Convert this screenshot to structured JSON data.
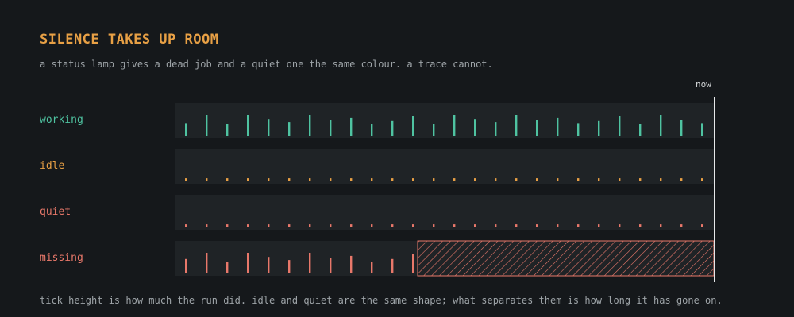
{
  "title": "SILENCE TAKES UP ROOM",
  "subtitle": "a status lamp gives a dead job and a quiet one the same colour. a trace cannot.",
  "now_label": "now",
  "footnote": "tick height is how much the run did. idle and quiet are the same shape; what separates them is how long it has gone on.",
  "colors": {
    "background": "#15181b",
    "lane": "#1f2326",
    "working": "#4fc3a1",
    "idle": "#e8a045",
    "quiet": "#e8786a",
    "missing": "#e8786a",
    "now_line": "#e6e8ea"
  },
  "chart_data": {
    "type": "timeline",
    "tick_count": 26,
    "value_meaning": "tick height = how much the run did (relative, 0-1)",
    "rows": [
      {
        "label": "working",
        "color_key": "working",
        "values": [
          0.6,
          1.0,
          0.55,
          1.0,
          0.8,
          0.65,
          1.0,
          0.75,
          0.85,
          0.55,
          0.7,
          0.95,
          0.55,
          1.0,
          0.8,
          0.65,
          1.0,
          0.75,
          0.85,
          0.6,
          0.7,
          0.95,
          0.55,
          1.0,
          0.75,
          0.6
        ],
        "missing_from_index": null
      },
      {
        "label": "idle",
        "color_key": "idle",
        "values": [
          0.15,
          0.15,
          0.15,
          0.15,
          0.15,
          0.15,
          0.15,
          0.15,
          0.15,
          0.15,
          0.15,
          0.15,
          0.15,
          0.15,
          0.15,
          0.15,
          0.15,
          0.15,
          0.15,
          0.15,
          0.15,
          0.15,
          0.15,
          0.15,
          0.15,
          0.15
        ],
        "missing_from_index": null
      },
      {
        "label": "quiet",
        "color_key": "quiet",
        "values": [
          0.15,
          0.15,
          0.15,
          0.15,
          0.15,
          0.15,
          0.15,
          0.15,
          0.15,
          0.15,
          0.15,
          0.15,
          0.15,
          0.15,
          0.15,
          0.15,
          0.15,
          0.15,
          0.15,
          0.15,
          0.15,
          0.15,
          0.15,
          0.15,
          0.15,
          0.15
        ],
        "missing_from_index": null
      },
      {
        "label": "missing",
        "color_key": "missing",
        "values": [
          0.7,
          1.0,
          0.55,
          1.0,
          0.8,
          0.65,
          1.0,
          0.75,
          0.85,
          0.55,
          0.7,
          0.95
        ],
        "missing_from_index": 12
      }
    ]
  }
}
